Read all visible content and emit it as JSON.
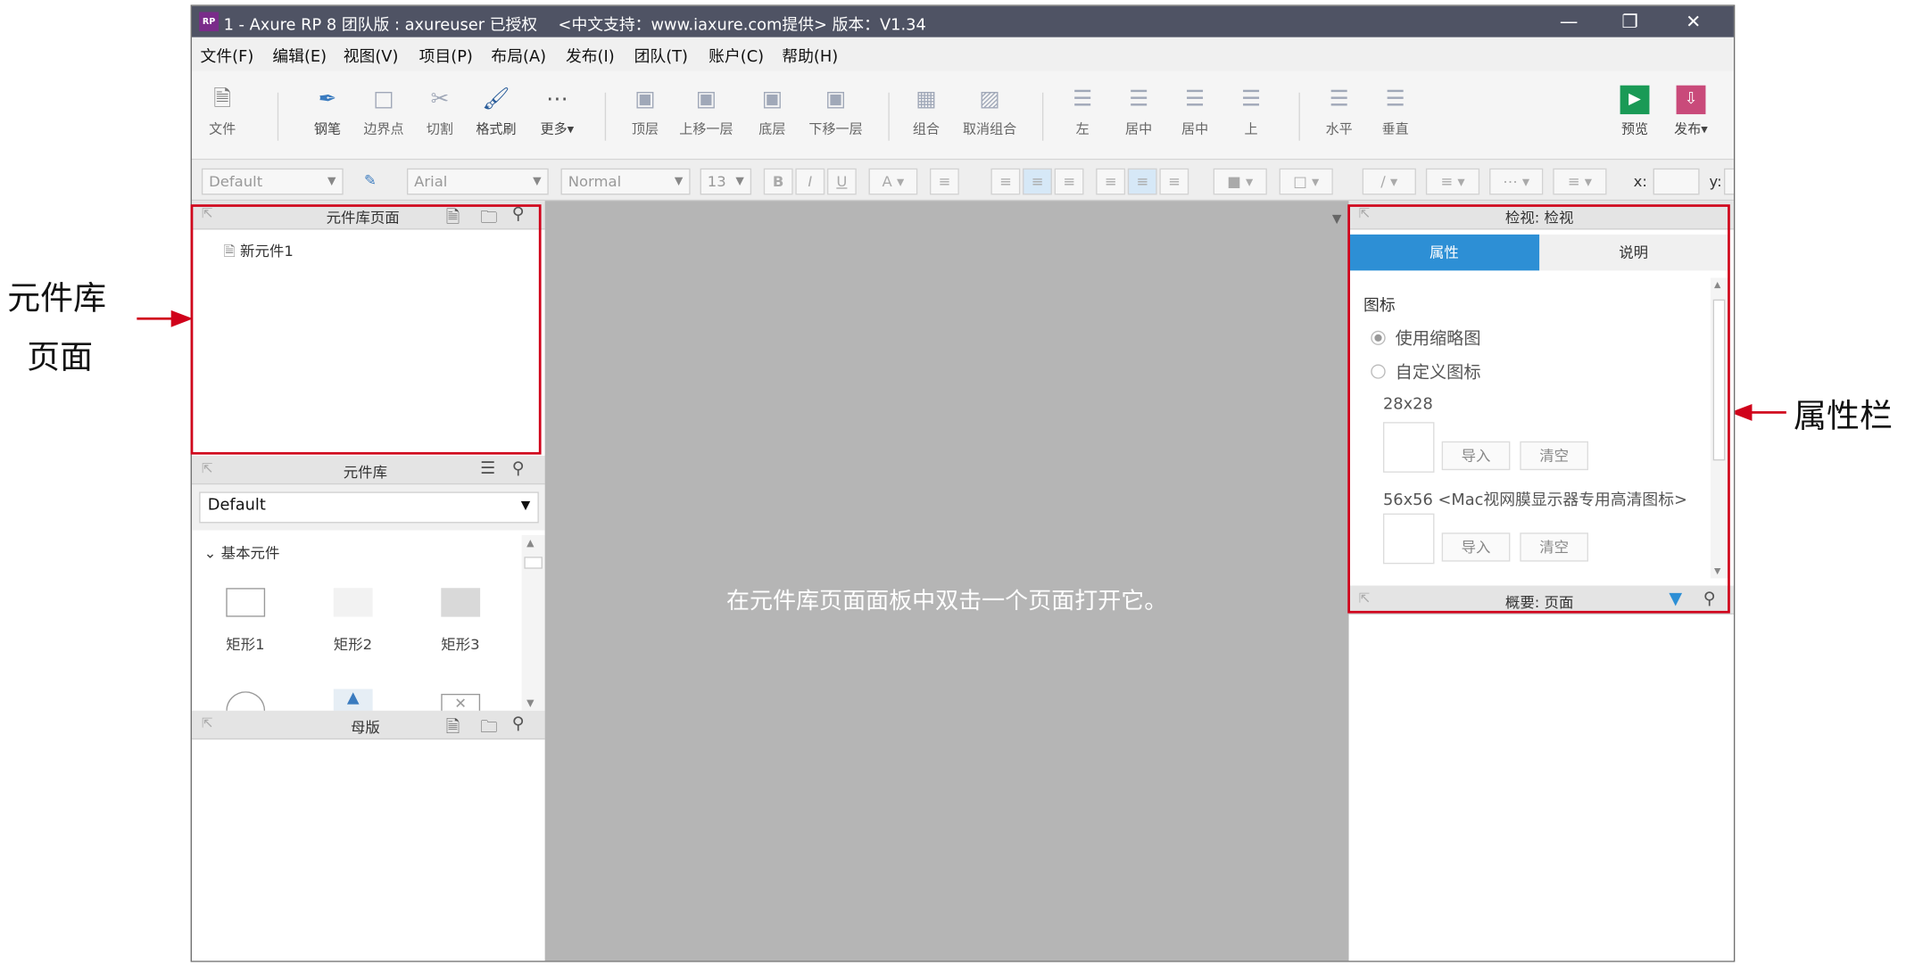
{
  "annotations": {
    "left_line1": "元件库",
    "left_line2": "页面",
    "right": "属性栏"
  },
  "window": {
    "title": "1 - Axure RP 8 团队版 : axureuser 已授权　 <中文支持：www.iaxure.com提供> 版本：V1.34",
    "app_icon": "RP",
    "minimize_icon": "minimize-icon",
    "restore_icon": "restore-icon",
    "close_icon": "close-icon"
  },
  "menu": [
    "文件(F)",
    "编辑(E)",
    "视图(V)",
    "项目(P)",
    "布局(A)",
    "发布(I)",
    "团队(T)",
    "账户(C)",
    "帮助(H)"
  ],
  "toolbar": {
    "file": "文件",
    "pen": "钢笔",
    "bounds": "边界点",
    "cut": "切割",
    "format_painter": "格式刷",
    "more": "更多▾",
    "top": "顶层",
    "up": "上移一层",
    "bottom": "底层",
    "down": "下移一层",
    "group": "组合",
    "ungroup": "取消组合",
    "left": "左",
    "center": "居中",
    "middle": "居中",
    "upper": "上",
    "horizontal": "水平",
    "vertical": "垂直",
    "preview": "预览",
    "publish": "发布▾"
  },
  "format": {
    "style": "Default",
    "font": "Arial",
    "weight": "Normal",
    "size": "13",
    "x_label": "x:",
    "y_label": "y:"
  },
  "pages_panel": {
    "title": "元件库页面",
    "item": "新元件1"
  },
  "library_panel": {
    "title": "元件库",
    "selected": "Default",
    "group": "基本元件",
    "widgets": [
      "矩形1",
      "矩形2",
      "矩形3"
    ]
  },
  "masters_panel": {
    "title": "母版"
  },
  "canvas": {
    "message": "在元件库页面面板中双击一个页面打开它。"
  },
  "inspector": {
    "title": "检视: 检视",
    "tab_props": "属性",
    "tab_notes": "说明",
    "section": "图标",
    "opt_thumb": "使用缩略图",
    "opt_custom": "自定义图标",
    "size1": "28x28",
    "size2": "56x56 <Mac视网膜显示器专用高清图标>",
    "import": "导入",
    "clear": "清空",
    "accent": "#2d8fd5"
  },
  "outline_panel": {
    "title": "概要: 页面"
  }
}
